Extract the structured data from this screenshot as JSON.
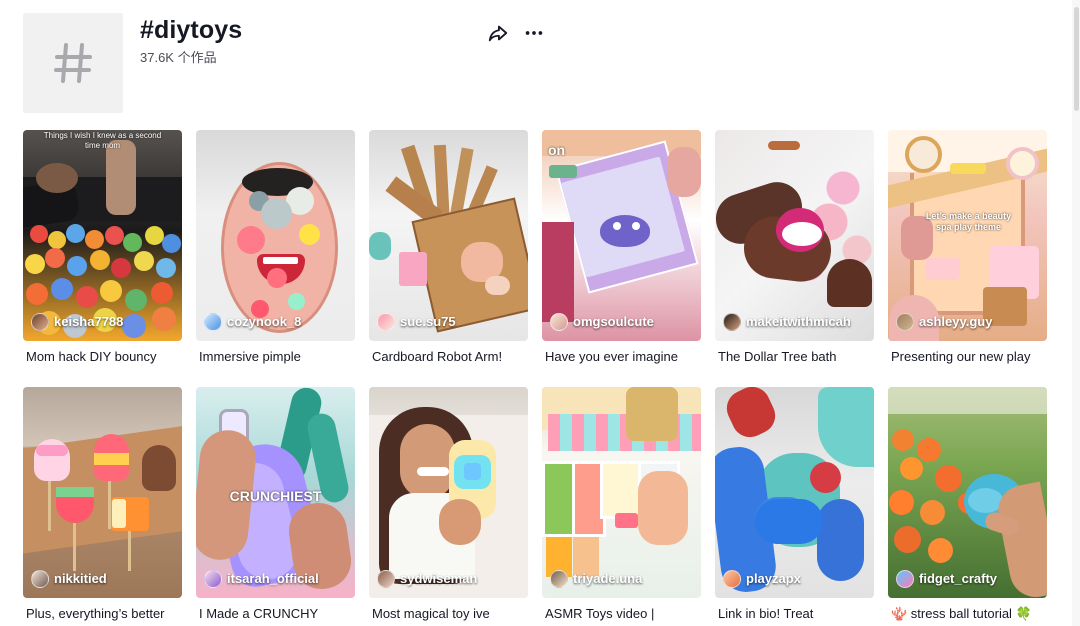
{
  "header": {
    "title": "#diytoys",
    "count": "37.6K 个作品",
    "hashtag_icon": "hashtag-icon",
    "share_icon": "share-arrow-icon",
    "more_icon": "more-dots-icon"
  },
  "videos": [
    {
      "overlay": "Things I wish I knew as a second time mom",
      "author": "keisha7788",
      "caption": "Mom hack DIY bouncy"
    },
    {
      "overlay": "",
      "author": "cozynook_8",
      "caption": "Immersive pimple"
    },
    {
      "overlay": "",
      "author": "sue.su75",
      "caption": "Cardboard Robot Arm!"
    },
    {
      "overlay": "on",
      "author": "omgsoulcute",
      "caption": "Have you ever imagine"
    },
    {
      "overlay": "",
      "author": "makeitwithmicah",
      "caption": "The Dollar Tree bath"
    },
    {
      "overlay": "Let’s make a beauty spa play theme",
      "author": "ashleyy.guy",
      "caption": "Presenting our new play"
    },
    {
      "overlay": "",
      "author": "nikkitied",
      "caption": "Plus, everything’s better"
    },
    {
      "overlay": "CRUNCHIEST",
      "author": "itsarah_official",
      "caption": "I Made a CRUNCHY"
    },
    {
      "overlay": "",
      "author": "sydwiseman",
      "caption": "Most magical toy ive"
    },
    {
      "overlay": "",
      "author": "triyade.una",
      "caption": "ASMR Toys video |"
    },
    {
      "overlay": "",
      "author": "playzapx",
      "caption": "Link in bio! Treat"
    },
    {
      "overlay": "",
      "author": "fidget_crafty",
      "caption": "🪸 stress ball tutorial 🍀"
    }
  ],
  "colors": {
    "text": "#161823",
    "secondary_text": "#4b4d57",
    "placeholder_bg": "#f1f1f2"
  }
}
